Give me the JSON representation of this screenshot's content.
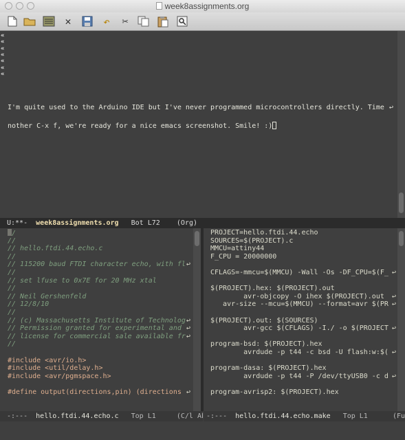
{
  "window": {
    "title": "week8assignments.org"
  },
  "toolbar": {
    "icons": [
      "new-file-icon",
      "open-folder-icon",
      "open-directory-icon",
      "close-icon",
      "save-icon",
      "undo-icon",
      "cut-icon",
      "copy-icon",
      "paste-icon",
      "search-icon"
    ]
  },
  "top_buffer": {
    "line1": "I'm quite used to the Arduino IDE but I've never programmed microcontrollers directly. Time",
    "line2": "nother C-x f, we're ready for a nice emacs screenshot. Smile! :)",
    "wrap_arrow": "↩",
    "fringe_mark": "«",
    "modeline": {
      "status": "U:**-",
      "buffer": "week8assignments.org",
      "position": "Bot L72",
      "mode": "(Org)"
    }
  },
  "left_buffer": {
    "lines": [
      {
        "t": "//",
        "c": "comment"
      },
      {
        "t": "//",
        "c": "comment"
      },
      {
        "t": "// hello.ftdi.44.echo.c",
        "c": "comment"
      },
      {
        "t": "//",
        "c": "comment"
      },
      {
        "t": "// 115200 baud FTDI character echo, with fl",
        "c": "comment",
        "wrap": true
      },
      {
        "t": "//",
        "c": "comment"
      },
      {
        "t": "// set lfuse to 0x7E for 20 MHz xtal",
        "c": "comment"
      },
      {
        "t": "//",
        "c": "comment"
      },
      {
        "t": "// Neil Gershenfeld",
        "c": "comment"
      },
      {
        "t": "// 12/8/10",
        "c": "comment"
      },
      {
        "t": "//",
        "c": "comment"
      },
      {
        "t": "// (c) Massachusetts Institute of Technolog",
        "c": "comment",
        "wrap": true
      },
      {
        "t": "// Permission granted for experimental and ",
        "c": "comment",
        "wrap": true
      },
      {
        "t": "// license for commercial sale available fr",
        "c": "comment",
        "wrap": true
      },
      {
        "t": "//",
        "c": "comment"
      },
      {
        "t": "",
        "c": "plain"
      },
      {
        "t": "#include <avr/io.h>",
        "c": "pre"
      },
      {
        "t": "#include <util/delay.h>",
        "c": "pre"
      },
      {
        "t": "#include <avr/pgmspace.h>",
        "c": "pre"
      },
      {
        "t": "",
        "c": "plain"
      },
      {
        "t": "#define output(directions,pin) (directions ",
        "c": "pre",
        "wrap": true
      }
    ],
    "modeline": {
      "status": "-:---",
      "buffer": "hello.ftdi.44.echo.c",
      "position": "Top L1",
      "mode": "(C/l Ab"
    }
  },
  "right_buffer": {
    "lines": [
      {
        "t": "PROJECT=hello.ftdi.44.echo"
      },
      {
        "t": "SOURCES=$(PROJECT).c"
      },
      {
        "t": "MMCU=attiny44"
      },
      {
        "t": "F_CPU = 20000000"
      },
      {
        "t": ""
      },
      {
        "t": "CFLAGS=-mmcu=$(MMCU) -Wall -Os -DF_CPU=$(F_",
        "wrap": true
      },
      {
        "t": ""
      },
      {
        "t": "$(PROJECT).hex: $(PROJECT).out"
      },
      {
        "t": "        avr-objcopy -O ihex $(PROJECT).out ",
        "wrap": true
      },
      {
        "t": "   avr-size --mcu=$(MMCU) --format=avr $(PR",
        "wrap": true
      },
      {
        "t": ""
      },
      {
        "t": "$(PROJECT).out: $(SOURCES)"
      },
      {
        "t": "        avr-gcc $(CFLAGS) -I./ -o $(PROJECT",
        "wrap": true
      },
      {
        "t": ""
      },
      {
        "t": "program-bsd: $(PROJECT).hex"
      },
      {
        "t": "        avrdude -p t44 -c bsd -U flash:w:$(",
        "wrap": true
      },
      {
        "t": ""
      },
      {
        "t": "program-dasa: $(PROJECT).hex"
      },
      {
        "t": "        avrdude -p t44 -P /dev/ttyUSB0 -c d",
        "wrap": true
      },
      {
        "t": ""
      },
      {
        "t": "program-avrisp2: $(PROJECT).hex"
      }
    ],
    "modeline": {
      "status": "-:---",
      "buffer": "hello.ftdi.44.echo.make",
      "position": "Top L1",
      "mode": "(Fu"
    }
  }
}
